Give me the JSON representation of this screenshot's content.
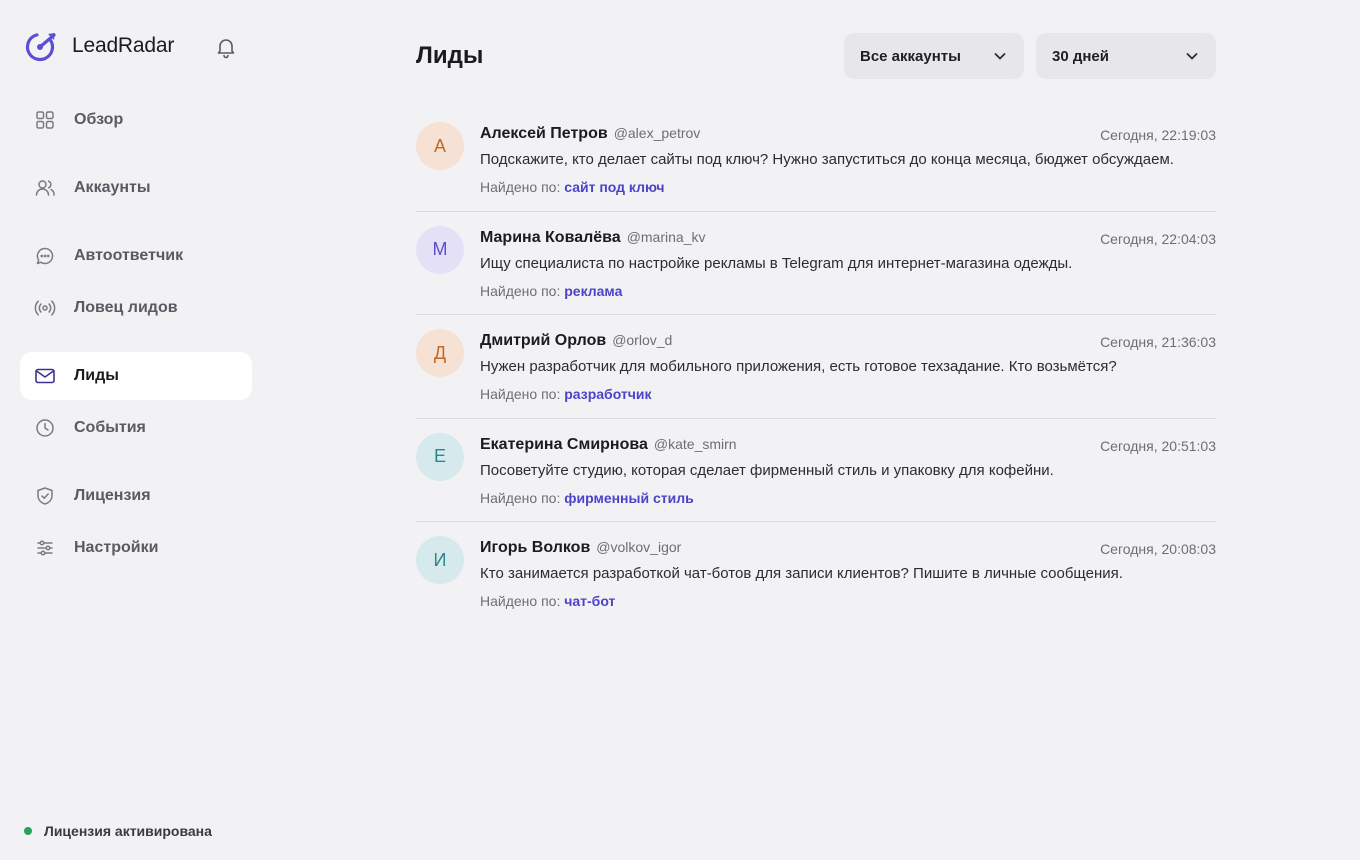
{
  "app": {
    "name": "LeadRadar"
  },
  "sidebar": {
    "items": [
      {
        "label": "Обзор",
        "icon": "grid-icon",
        "active": false
      },
      {
        "label": "Аккаунты",
        "icon": "users-icon",
        "active": false
      },
      {
        "label": "Автоответчик",
        "icon": "chat-bubble-icon",
        "active": false
      },
      {
        "label": "Ловец лидов",
        "icon": "radio-waves-icon",
        "active": false
      },
      {
        "label": "Лиды",
        "icon": "mail-icon",
        "active": true
      },
      {
        "label": "События",
        "icon": "clock-icon",
        "active": false
      },
      {
        "label": "Лицензия",
        "icon": "shield-check-icon",
        "active": false
      },
      {
        "label": "Настройки",
        "icon": "sliders-icon",
        "active": false
      }
    ],
    "license_status": "Лицензия активирована"
  },
  "header": {
    "title": "Лиды",
    "account_filter": "Все аккаунты",
    "period_filter": "30 дней"
  },
  "found_by_label": "Найдено по:",
  "leads": [
    {
      "initial": "А",
      "name": "Алексей Петров",
      "handle": "@alex_petrov",
      "time": "Сегодня, 22:19:03",
      "message": "Подскажите, кто делает сайты под ключ? Нужно запуститься до конца месяца, бюджет обсуждаем.",
      "keyword": "сайт под ключ",
      "avatar_bg": "#f5e2d4",
      "avatar_fg": "#c06a2a"
    },
    {
      "initial": "М",
      "name": "Марина Ковалёва",
      "handle": "@marina_kv",
      "time": "Сегодня, 22:04:03",
      "message": "Ищу специалиста по настройке рекламы в Telegram для интернет-магазина одежды.",
      "keyword": "реклама",
      "avatar_bg": "#e4e1f6",
      "avatar_fg": "#5a4fc9"
    },
    {
      "initial": "Д",
      "name": "Дмитрий Орлов",
      "handle": "@orlov_d",
      "time": "Сегодня, 21:36:03",
      "message": "Нужен разработчик для мобильного приложения, есть готовое техзадание. Кто возьмётся?",
      "keyword": "разработчик",
      "avatar_bg": "#f5e2d4",
      "avatar_fg": "#c06a2a"
    },
    {
      "initial": "Е",
      "name": "Екатерина Смирнова",
      "handle": "@kate_smirn",
      "time": "Сегодня, 20:51:03",
      "message": "Посоветуйте студию, которая сделает фирменный стиль и упаковку для кофейни.",
      "keyword": "фирменный стиль",
      "avatar_bg": "#d6e9ec",
      "avatar_fg": "#2a8690"
    },
    {
      "initial": "И",
      "name": "Игорь Волков",
      "handle": "@volkov_igor",
      "time": "Сегодня, 20:08:03",
      "message": "Кто занимается разработкой чат-ботов для записи клиентов? Пишите в личные сообщения.",
      "keyword": "чат-бот",
      "avatar_bg": "#d6e9ec",
      "avatar_fg": "#2a8690"
    }
  ],
  "colors": {
    "accent": "#4b43c9",
    "background": "#f2f2f4",
    "status_ok": "#28a160"
  }
}
